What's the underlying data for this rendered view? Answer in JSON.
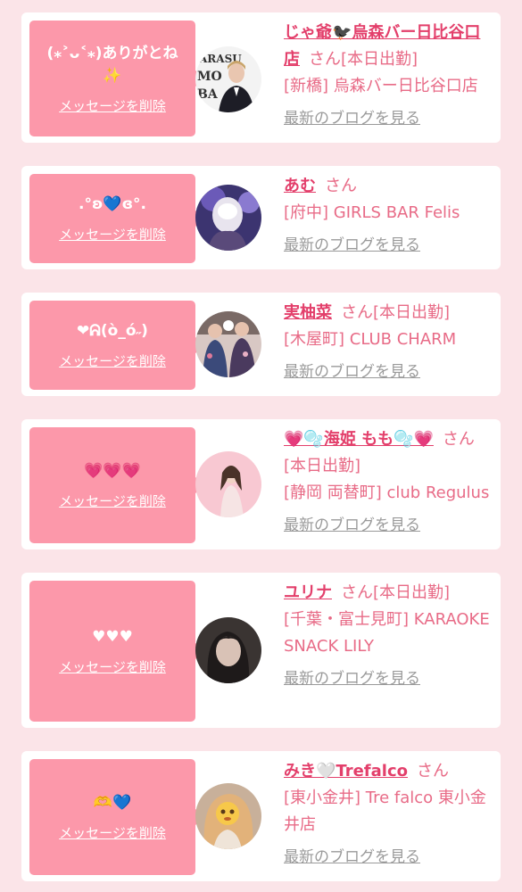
{
  "cards": [
    {
      "message": "(⁎˃ᴗ˂⁎)ありがとね\n✨",
      "delete_label": "メッセージを削除",
      "name": "じゃ爺🐦‍⬛烏森バー日比谷口店",
      "san": "さん",
      "status": "[本日出勤]",
      "shop": "[新橋] 烏森バー日比谷口店",
      "blog_label": "最新のブログを見る",
      "avatar": "shop-logo-man-avatar"
    },
    {
      "message": ".°ʚ💙ɞ°.",
      "delete_label": "メッセージを削除",
      "name": "あむ",
      "san": "さん",
      "status": "",
      "shop": "[府中] GIRLS BAR Felis",
      "blog_label": "最新のブログを見る",
      "avatar": "blurred-face-avatar"
    },
    {
      "message": "❤︎ᕱ(ò_ó˶)",
      "delete_label": "メッセージを削除",
      "name": "実柚菜",
      "san": "さん",
      "status": "[本日出勤]",
      "shop": "[木屋町] CLUB CHARM",
      "blog_label": "最新のブログを見る",
      "avatar": "yukata-group-avatar"
    },
    {
      "message": "💗💗💗",
      "delete_label": "メッセージを削除",
      "name": "💗🫧海姫 もも🫧💗",
      "san": "さん",
      "status": "[本日出勤]",
      "shop": "[静岡 両替町] club Regulus",
      "blog_label": "最新のブログを見る",
      "avatar": "pink-dress-avatar"
    },
    {
      "message": "♥♥♥",
      "delete_label": "メッセージを削除",
      "name": "ユリナ",
      "san": "さん",
      "status": "[本日出勤]",
      "shop": "[千葉・富士見町] KARAOKE SNACK LILY",
      "blog_label": "最新のブログを見る",
      "avatar": "dark-portrait-avatar"
    },
    {
      "message": "🫶💙",
      "delete_label": "メッセージを削除",
      "name": "みき🤍Trefalco",
      "san": "さん",
      "status": "",
      "shop": "[東小金井] Tre falco 東小金井店",
      "blog_label": "最新のブログを見る",
      "avatar": "emoji-face-avatar"
    }
  ]
}
